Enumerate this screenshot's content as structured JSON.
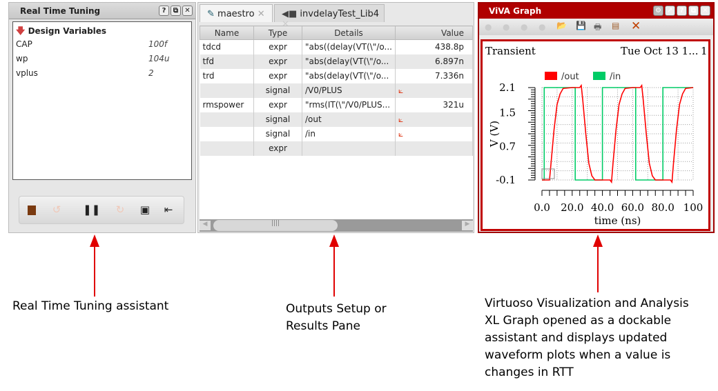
{
  "rtt": {
    "title": "Real Time Tuning",
    "section": "Design Variables",
    "variables": [
      {
        "name": "CAP",
        "value": "100f"
      },
      {
        "name": "wp",
        "value": "104u"
      },
      {
        "name": "vplus",
        "value": "2"
      }
    ],
    "help": "?",
    "float": "⧉",
    "close": "✕"
  },
  "maestro": {
    "tabs": [
      {
        "label": "maestro",
        "close": "✕"
      },
      {
        "label": "invdelayTest_Lib4",
        "close": "✕"
      }
    ],
    "columns": [
      "Name",
      "Type",
      "Details",
      "Value"
    ],
    "rows": [
      {
        "name": "tdcd",
        "type": "expr",
        "details": "\"abs((delay(VT(\\\"/o...",
        "value": "438.8p",
        "plot": false
      },
      {
        "name": "tfd",
        "type": "expr",
        "details": "\"abs(delay(VT(\\\"/o...",
        "value": "6.897n",
        "plot": false
      },
      {
        "name": "trd",
        "type": "expr",
        "details": "\"abs(delay(VT(\\\"/o...",
        "value": "7.336n",
        "plot": false
      },
      {
        "name": "",
        "type": "signal",
        "details": "/V0/PLUS",
        "value": "",
        "plot": true
      },
      {
        "name": "rmspower",
        "type": "expr",
        "details": "\"rms(IT(\\\"/V0/PLUS...",
        "value": "321u",
        "plot": false
      },
      {
        "name": "",
        "type": "signal",
        "details": "/out",
        "value": "",
        "plot": true
      },
      {
        "name": "",
        "type": "signal",
        "details": "/in",
        "value": "",
        "plot": true
      },
      {
        "name": "",
        "type": "expr",
        "details": "",
        "value": "",
        "plot": false
      }
    ]
  },
  "viva": {
    "title": "ViVA Graph",
    "plot_title": "Transient",
    "date": "Tue Oct 13 1...",
    "subwindow": "1"
  },
  "chart_data": {
    "type": "line",
    "xlabel": "time (ns)",
    "ylabel": "V (V)",
    "xlim": [
      0,
      100
    ],
    "ylim": [
      -0.1,
      2.1
    ],
    "xticks": [
      "0.0",
      "20.0",
      "40.0",
      "60.0",
      "80.0",
      "100"
    ],
    "yticks": [
      "2.1",
      "1.5",
      "0.7",
      "-0.1"
    ],
    "ytick_values": [
      2.1,
      1.5,
      0.7,
      -0.1
    ],
    "series": [
      {
        "name": "/out",
        "color": "#ff0000",
        "x": [
          0,
          5,
          6,
          8,
          10,
          12,
          14,
          20,
          25,
          26,
          27,
          29,
          31,
          33,
          35,
          40,
          45,
          46,
          47,
          49,
          51,
          53,
          55,
          60,
          65,
          66,
          67,
          69,
          71,
          73,
          75,
          80,
          85,
          86,
          87,
          89,
          91,
          93,
          95,
          100
        ],
        "y": [
          -0.1,
          -0.1,
          0.3,
          1.1,
          1.7,
          1.95,
          2.08,
          2.1,
          2.1,
          2.15,
          1.8,
          1.0,
          0.3,
          0.0,
          -0.1,
          -0.1,
          -0.1,
          -0.15,
          0.3,
          1.1,
          1.7,
          1.95,
          2.08,
          2.1,
          2.1,
          2.15,
          1.8,
          1.0,
          0.3,
          0.0,
          -0.1,
          -0.1,
          -0.1,
          -0.15,
          0.3,
          1.1,
          1.7,
          1.95,
          2.08,
          2.1
        ]
      },
      {
        "name": "/in",
        "color": "#00cc66",
        "x": [
          0,
          1.5,
          1.5,
          22,
          22,
          40,
          40,
          62,
          62,
          80,
          80,
          100
        ],
        "y": [
          -0.1,
          -0.1,
          2.1,
          2.1,
          -0.1,
          -0.1,
          2.1,
          2.1,
          -0.1,
          -0.1,
          2.1,
          2.1
        ]
      }
    ]
  },
  "annotations": [
    {
      "text": "Real Time Tuning assistant"
    },
    {
      "text": "Outputs Setup or Results Pane"
    },
    {
      "text": "Virtuoso Visualization and Analysis XL Graph opened as a dockable assistant and displays updated waveform plots when a value is changes in RTT"
    }
  ]
}
